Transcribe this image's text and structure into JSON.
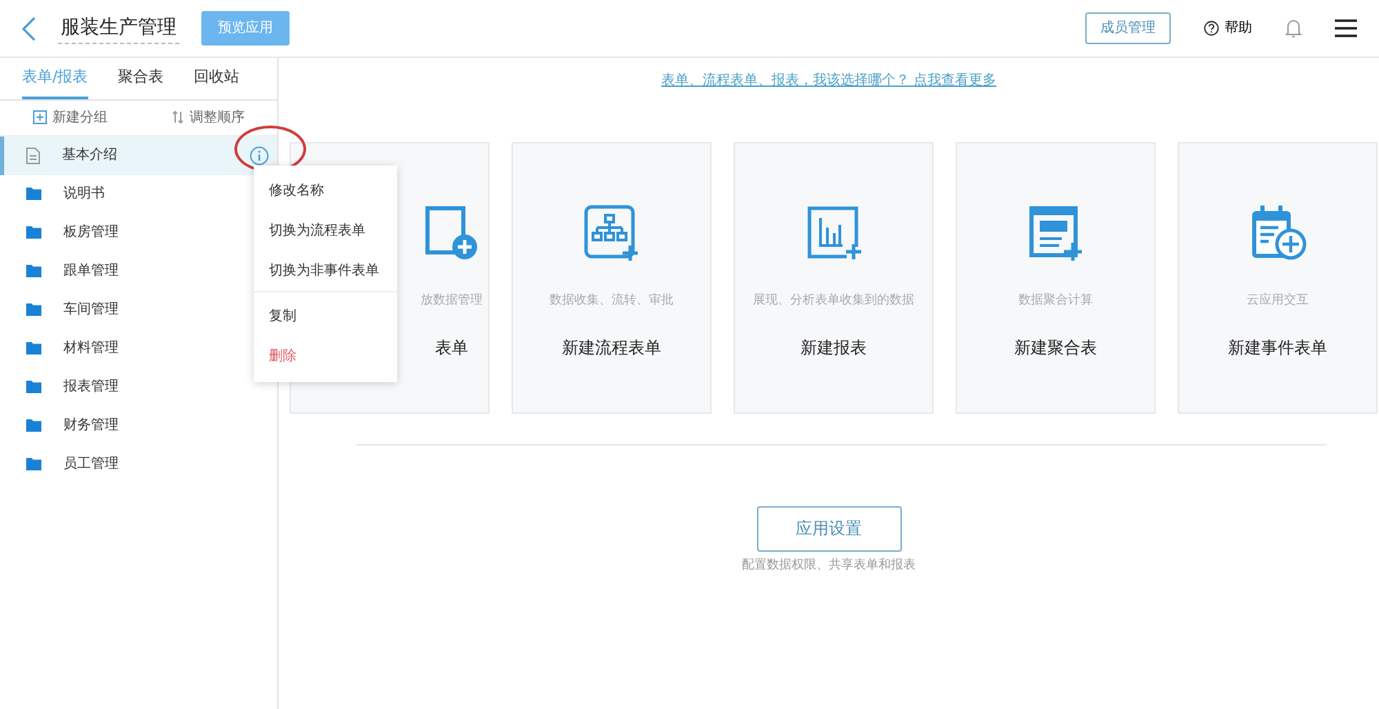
{
  "header": {
    "app_name": "服装生产管理",
    "preview_button": "预览应用",
    "members_button": "成员管理",
    "help": "帮助"
  },
  "sidebar": {
    "tabs": [
      {
        "label": "表单/报表",
        "selected": true
      },
      {
        "label": "聚合表",
        "selected": false
      },
      {
        "label": "回收站",
        "selected": false
      }
    ],
    "actions": [
      "新建分组",
      "调整顺序"
    ],
    "items": [
      {
        "label": "基本介绍",
        "kind": "form",
        "selected": true
      },
      {
        "label": "说明书",
        "kind": "folder",
        "selected": false
      },
      {
        "label": "板房管理",
        "kind": "folder",
        "selected": false
      },
      {
        "label": "跟单管理",
        "kind": "folder",
        "selected": false
      },
      {
        "label": "车间管理",
        "kind": "folder",
        "selected": false
      },
      {
        "label": "材料管理",
        "kind": "folder",
        "selected": false
      },
      {
        "label": "报表管理",
        "kind": "folder",
        "selected": false
      },
      {
        "label": "财务管理",
        "kind": "folder",
        "selected": false
      },
      {
        "label": "员工管理",
        "kind": "folder",
        "selected": false
      }
    ]
  },
  "context_menu": [
    {
      "label": "修改名称",
      "kind": "normal",
      "divider_after": false
    },
    {
      "label": "切换为流程表单",
      "kind": "normal",
      "divider_after": false
    },
    {
      "label": "切换为非事件表单",
      "kind": "normal",
      "divider_after": true
    },
    {
      "label": "复制",
      "kind": "normal",
      "divider_after": false
    },
    {
      "label": "删除",
      "kind": "danger",
      "divider_after": false
    }
  ],
  "main": {
    "hint": "表单、流程表单、报表，我该选择哪个？ 点我查看更多",
    "cards": [
      {
        "kind": "form",
        "description": "放数据管理",
        "title": "表单"
      },
      {
        "kind": "flow",
        "description": "数据收集、流转、审批",
        "title": "新建流程表单"
      },
      {
        "kind": "report",
        "description": "展现、分析表单收集到的数据",
        "title": "新建报表"
      },
      {
        "kind": "aggregate",
        "description": "数据聚合计算",
        "title": "新建聚合表"
      },
      {
        "kind": "event",
        "description": "云应用交互",
        "title": "新建事件表单"
      }
    ],
    "settings_button": "应用设置",
    "settings_caption": "配置数据权限、共享表单和报表"
  }
}
